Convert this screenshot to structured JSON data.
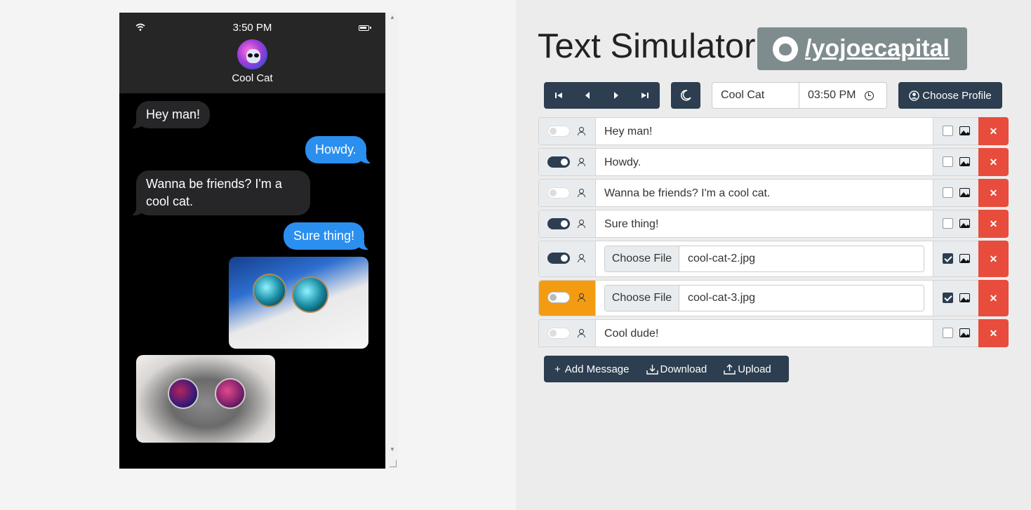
{
  "phone": {
    "status_time": "3:50 PM",
    "contact_name": "Cool Cat",
    "messages": [
      {
        "text": "Hey man!",
        "sender": "them"
      },
      {
        "text": "Howdy.",
        "sender": "me"
      },
      {
        "text": "Wanna be friends? I'm a cool cat.",
        "sender": "them"
      },
      {
        "text": "Sure thing!",
        "sender": "me"
      }
    ],
    "images": [
      {
        "sender": "me",
        "icon": "cat-sunglasses-blue-image"
      },
      {
        "sender": "them",
        "icon": "cat-sunglasses-galaxy-image"
      }
    ]
  },
  "header": {
    "title": "Text Simulator",
    "github_label": "/yojoecapital"
  },
  "toolbar": {
    "name_value": "Cool Cat",
    "time_value": "03:50 PM",
    "choose_profile_label": "Choose Profile"
  },
  "rows": [
    {
      "type": "text",
      "text": "Hey man!",
      "sent": false,
      "image": false
    },
    {
      "type": "text",
      "text": "Howdy.",
      "sent": true,
      "image": false
    },
    {
      "type": "text",
      "text": "Wanna be friends? I'm a cool cat.",
      "sent": false,
      "image": false
    },
    {
      "type": "text",
      "text": "Sure thing!",
      "sent": true,
      "image": false
    },
    {
      "type": "file",
      "button": "Choose File",
      "file": "cool-cat-2.jpg",
      "sent": true,
      "image": true
    },
    {
      "type": "file",
      "button": "Choose File",
      "file": "cool-cat-3.jpg",
      "sent": false,
      "image": true,
      "highlighted": true
    },
    {
      "type": "text",
      "text": "Cool dude!",
      "sent": false,
      "image": false
    }
  ],
  "bottom": {
    "add_label": "Add Message",
    "add_prefix": "+",
    "download_label": "Download",
    "upload_label": "Upload"
  },
  "colors": {
    "primary": "#2c3e50",
    "danger": "#e74c3c",
    "warning": "#f39c12",
    "bubble_me": "#2b8ff0",
    "bubble_them": "#262628",
    "github_button": "#7f8c8d"
  }
}
